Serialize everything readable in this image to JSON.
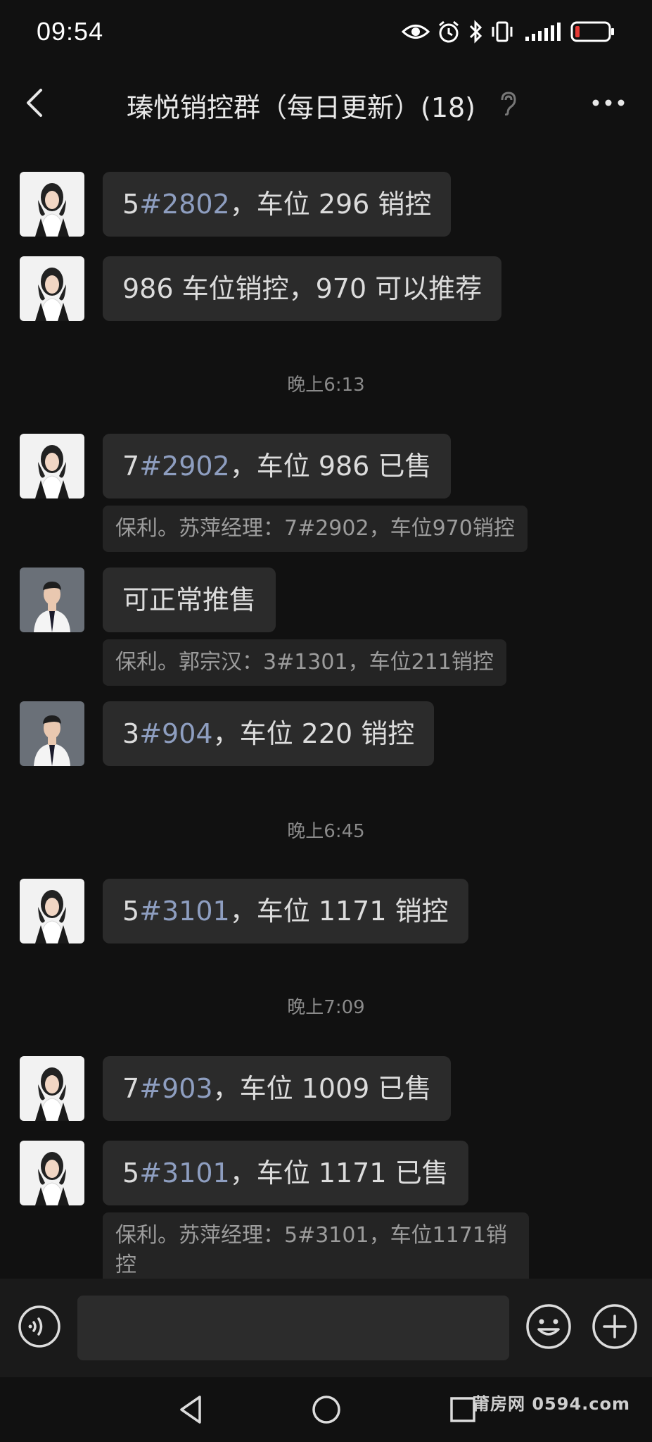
{
  "status_bar": {
    "time": "09:54"
  },
  "header": {
    "title": "瑧悦销控群（每日更新）(18)",
    "icons": [
      "back-arrow-icon",
      "ear-icon",
      "more-dots-icon"
    ]
  },
  "colors": {
    "background": "#111111",
    "bubble": "#2b2b2b",
    "quote": "#242424",
    "hash_accent": "#8e9ec0"
  },
  "messages": [
    {
      "sender": "female",
      "pre": "5",
      "hash": "#2802",
      "post": "，车位 296 销控"
    },
    {
      "sender": "female",
      "pre": "986 车位销控，970 可以推荐",
      "hash": "",
      "post": ""
    },
    {
      "sender": "female",
      "pre": "7",
      "hash": "#2902",
      "post": "，车位 986 已售"
    },
    {
      "sender": "male",
      "pre": "可正常推售",
      "hash": "",
      "post": ""
    },
    {
      "sender": "male",
      "pre": "3",
      "hash": "#904",
      "post": "，车位 220 销控"
    },
    {
      "sender": "female",
      "pre": "5",
      "hash": "#3101",
      "post": "，车位 1171 销控"
    },
    {
      "sender": "female",
      "pre": "7",
      "hash": "#903",
      "post": "，车位 1009 已售"
    },
    {
      "sender": "female",
      "pre": "5",
      "hash": "#3101",
      "post": "，车位 1171 已售"
    }
  ],
  "quotes": [
    {
      "text": "保利。苏萍经理：7#2902，车位970销控"
    },
    {
      "text": "保利。郭宗汉：3#1301，车位211销控"
    },
    {
      "text": "保利。苏萍经理：5#3101，车位1171销控"
    }
  ],
  "time_dividers": [
    "晚上6:13",
    "晚上6:45",
    "晚上7:09"
  ],
  "input_bar": {
    "value": "",
    "icons": [
      "voice-icon",
      "emoji-icon",
      "plus-icon"
    ]
  },
  "nav_bar": {
    "icons": [
      "nav-back-icon",
      "nav-home-icon",
      "nav-recent-icon"
    ]
  },
  "watermark": "莆房网 0594.com"
}
